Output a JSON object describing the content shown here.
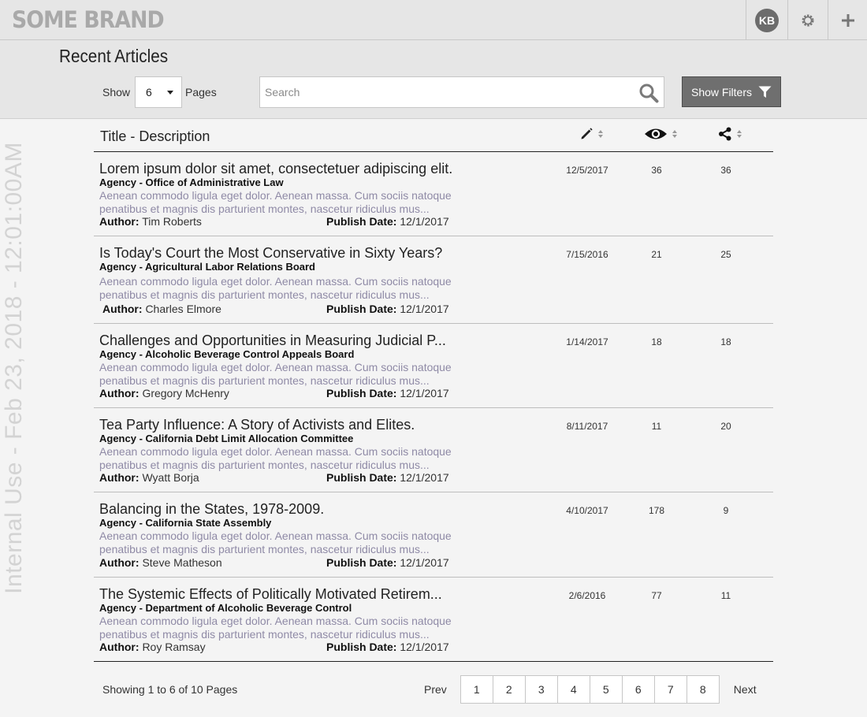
{
  "brand": "SOME BRAND",
  "topbar": {
    "avatar_initials": "KB",
    "icons": [
      "gear-icon",
      "plus-icon"
    ]
  },
  "header": {
    "title": "Recent Articles",
    "show_label": "Show",
    "pages_value": "6",
    "pages_label": "Pages",
    "search_placeholder": "Search",
    "filter_button": "Show Filters"
  },
  "watermark": "Internal Use - Feb 23, 2018 - 12:01:00AM",
  "table": {
    "title_header": "Title - Description",
    "column_icons": [
      "pencil-icon",
      "eye-icon",
      "share-icon"
    ],
    "author_label": "Author:",
    "publish_label": "Publish Date:",
    "rows": [
      {
        "title": "Lorem ipsum dolor sit amet, consectetuer adipiscing elit.",
        "agency": "Agency - Office of Administrative Law",
        "description": "Aenean commodo ligula eget dolor. Aenean massa. Cum sociis natoque penatibus et magnis dis parturient montes, nascetur ridiculus mus...",
        "author": "Tim Roberts",
        "publish_date": "12/1/2017",
        "edited": "12/5/2017",
        "views": "36",
        "shares": "36"
      },
      {
        "title": "Is Today's Court the Most Conservative in Sixty Years?",
        "agency": "Agency - Agricultural Labor Relations Board",
        "description": "Aenean commodo ligula eget dolor. Aenean massa. Cum sociis natoque penatibus et magnis dis parturient montes, nascetur ridiculus mus...",
        "author": "Charles Elmore",
        "publish_date": "12/1/2017",
        "edited": "7/15/2016",
        "views": "21",
        "shares": "25"
      },
      {
        "title": "Challenges and Opportunities in Measuring Judicial P...",
        "agency": "Agency - Alcoholic Beverage Control Appeals Board",
        "description": "Aenean commodo ligula eget dolor. Aenean massa. Cum sociis natoque penatibus et magnis dis parturient montes, nascetur ridiculus mus...",
        "author": "Gregory McHenry",
        "publish_date": "12/1/2017",
        "edited": "1/14/2017",
        "views": "18",
        "shares": "18"
      },
      {
        "title": "Tea Party Influence: A Story of Activists and Elites.",
        "agency": "Agency - California Debt Limit Allocation Committee",
        "description": "Aenean commodo ligula eget dolor. Aenean massa. Cum sociis natoque penatibus et magnis dis parturient montes, nascetur ridiculus mus...",
        "author": "Wyatt Borja",
        "publish_date": "12/1/2017",
        "edited": "8/11/2017",
        "views": "11",
        "shares": "20"
      },
      {
        "title": "Balancing in the States, 1978-2009.",
        "agency": "Agency - California State Assembly",
        "description": "Aenean commodo ligula eget dolor. Aenean massa. Cum sociis natoque penatibus et magnis dis parturient montes, nascetur ridiculus mus...",
        "author": "Steve Matheson",
        "publish_date": "12/1/2017",
        "edited": "4/10/2017",
        "views": "178",
        "shares": "9"
      },
      {
        "title": "The Systemic Effects of Politically Motivated Retirem...",
        "agency": "Agency - Department of Alcoholic Beverage Control",
        "description": "Aenean commodo ligula eget dolor. Aenean massa. Cum sociis natoque penatibus et magnis dis parturient montes, nascetur ridiculus mus...",
        "author": "Roy Ramsay",
        "publish_date": "12/1/2017",
        "edited": "2/6/2016",
        "views": "77",
        "shares": "11"
      }
    ]
  },
  "footer": {
    "showing": "Showing 1 to 6 of 10 Pages",
    "prev": "Prev",
    "next": "Next",
    "pages": [
      "1",
      "2",
      "3",
      "4",
      "5",
      "6",
      "7",
      "8"
    ]
  }
}
